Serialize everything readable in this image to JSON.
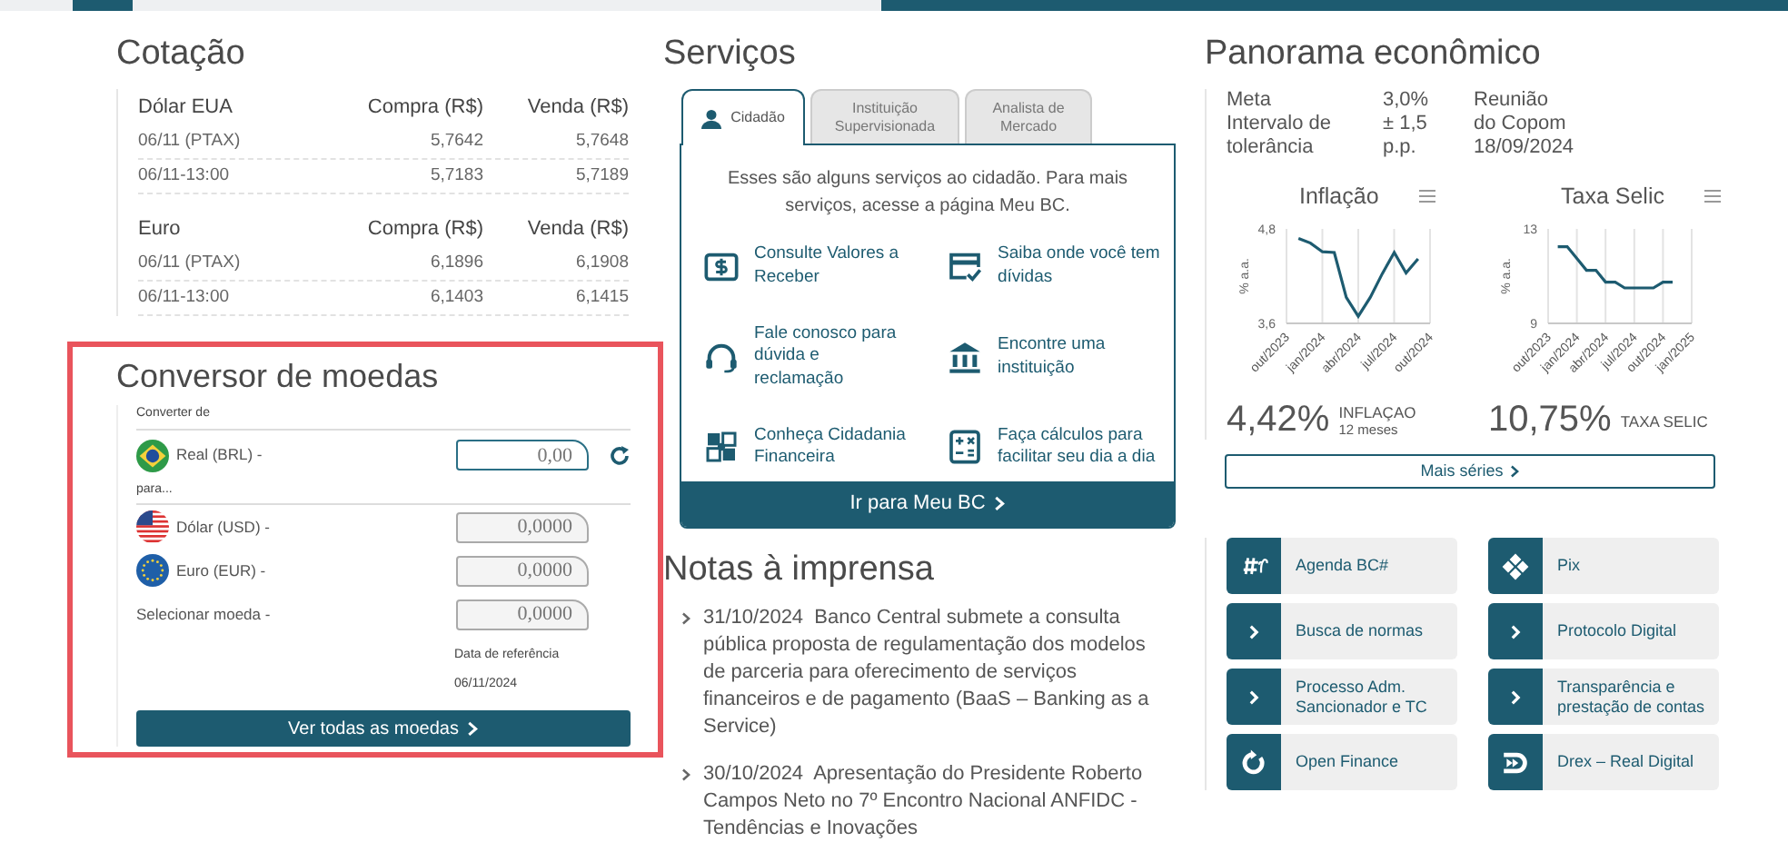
{
  "quotes": {
    "title": "Cotação",
    "groups": [
      {
        "currency": "Dólar EUA",
        "buy_header": "Compra (R$)",
        "sell_header": "Venda (R$)",
        "rows": [
          {
            "label": "06/11 (PTAX)",
            "buy": "5,7642",
            "sell": "5,7648"
          },
          {
            "label": "06/11-13:00",
            "buy": "5,7183",
            "sell": "5,7189"
          }
        ]
      },
      {
        "currency": "Euro",
        "buy_header": "Compra (R$)",
        "sell_header": "Venda (R$)",
        "rows": [
          {
            "label": "06/11 (PTAX)",
            "buy": "6,1896",
            "sell": "6,1908"
          },
          {
            "label": "06/11-13:00",
            "buy": "6,1403",
            "sell": "6,1415"
          }
        ]
      }
    ]
  },
  "converter": {
    "title": "Conversor de moedas",
    "from_label": "Converter de",
    "from": {
      "kind": "br",
      "currency": "Real (BRL) -",
      "value": "0,00"
    },
    "to_label": "para...",
    "targets": [
      {
        "kind": "us",
        "currency": "Dólar (USD) -",
        "value": "0,0000"
      },
      {
        "kind": "eu",
        "currency": "Euro (EUR) -",
        "value": "0,0000"
      },
      {
        "kind": "none",
        "currency": "Selecionar moeda -",
        "value": "0,0000"
      }
    ],
    "date_label": "Data de referência",
    "date": "06/11/2024",
    "button": "Ver todas as moedas"
  },
  "services": {
    "title": "Serviços",
    "tabs": [
      {
        "kind": "person",
        "label": "Cidadão",
        "selected": true
      },
      {
        "kind": "plain",
        "label": "Instituição Supervisionada",
        "selected": false
      },
      {
        "kind": "plain",
        "label": "Analista de Mercado",
        "selected": false
      }
    ],
    "intro": "Esses são alguns serviços ao cidadão. Para mais serviços, acesse a página ",
    "intro_link": "Meu BC",
    "intro_end": ".",
    "items": [
      {
        "kind": "money",
        "label": "Consulte Valores a Receber"
      },
      {
        "kind": "card",
        "label": "Saiba onde você tem dívidas"
      },
      {
        "kind": "headset",
        "label": "Fale conosco para dúvida e reclamação"
      },
      {
        "kind": "bank",
        "label": "Encontre uma instituição"
      },
      {
        "kind": "puzzle",
        "label": "Conheça Cidadania Financeira"
      },
      {
        "kind": "calculator",
        "label": "Faça cálculos para facilitar seu dia a dia"
      }
    ],
    "button": "Ir para Meu BC"
  },
  "press": {
    "title": "Notas à imprensa",
    "items": [
      {
        "date": "31/10/2024",
        "title": "Banco Central submete a consulta pública proposta de regulamentação dos modelos de parceria para oferecimento de serviços financeiros e de pagamento (BaaS – Banking as a Service)"
      },
      {
        "date": "30/10/2024",
        "title": "Apresentação do Presidente Roberto Campos Neto no 7º Encontro Nacional ANFIDC - Tendências e Inovações"
      }
    ]
  },
  "economy": {
    "title": "Panorama econômico",
    "target_label": "Meta",
    "range_label": "Intervalo de tolerância",
    "target": "3,0%",
    "range": "± 1,5 p.p.",
    "meeting_label": "Reunião do Copom",
    "meeting_date": "18/09/2024",
    "charts": [
      {
        "title": "Inflação",
        "value": "4,42%",
        "caption": "INFLAÇAO",
        "subcaption": "12 meses",
        "chart_data": {
          "type": "line",
          "ylabel": "% a.a.",
          "categories": [
            "out/2023",
            null,
            null,
            "jan/2024",
            null,
            null,
            "abr/2024",
            null,
            null,
            "jul/2024",
            null,
            null,
            "out/2024"
          ],
          "grid": true,
          "series": [
            {
              "color": "#1d5b70",
              "values": [
                null,
                4.68,
                4.62,
                4.51,
                4.5,
                3.93,
                3.69,
                3.93,
                4.23,
                4.5,
                4.24,
                4.42,
                null
              ]
            }
          ],
          "ylim": [
            3.6,
            4.8
          ],
          "yticks": [
            {
              "value": 3.6,
              "label": "3,6"
            },
            {
              "value": 4.8,
              "label": "4,8"
            }
          ]
        }
      },
      {
        "title": "Taxa Selic",
        "value": "10,75%",
        "caption": "TAXA SELIC",
        "chart_data": {
          "type": "line",
          "ylabel": "% a.a.",
          "categories": [
            "out/2023",
            null,
            null,
            "jan/2024",
            null,
            null,
            "abr/2024",
            null,
            null,
            "jul/2024",
            null,
            null,
            "out/2024",
            null,
            null,
            "jan/2025"
          ],
          "grid": true,
          "series": [
            {
              "color": "#1d5b70",
              "values": [
                null,
                12.25,
                12.25,
                11.75,
                11.25,
                11.25,
                10.75,
                10.75,
                10.5,
                10.5,
                10.5,
                10.5,
                10.75,
                10.75,
                null,
                null
              ]
            }
          ],
          "ylim": [
            9,
            13
          ],
          "yticks": [
            {
              "value": 9,
              "label": "9"
            },
            {
              "value": 13,
              "label": "13"
            }
          ]
        }
      }
    ],
    "button": "Mais séries"
  },
  "links": [
    {
      "kind": "agenda",
      "label": "Agenda BC#"
    },
    {
      "kind": "pix",
      "label": "Pix"
    },
    {
      "kind": "chevron",
      "label": "Busca de normas"
    },
    {
      "kind": "chevron",
      "label": "Protocolo Digital"
    },
    {
      "kind": "chevron",
      "label": "Processo Adm. Sancionador e TC"
    },
    {
      "kind": "chevron",
      "label": "Transparência e prestação de contas"
    },
    {
      "kind": "openfinance",
      "label": "Open Finance"
    },
    {
      "kind": "drex",
      "label": "Drex – Real Digital"
    }
  ]
}
